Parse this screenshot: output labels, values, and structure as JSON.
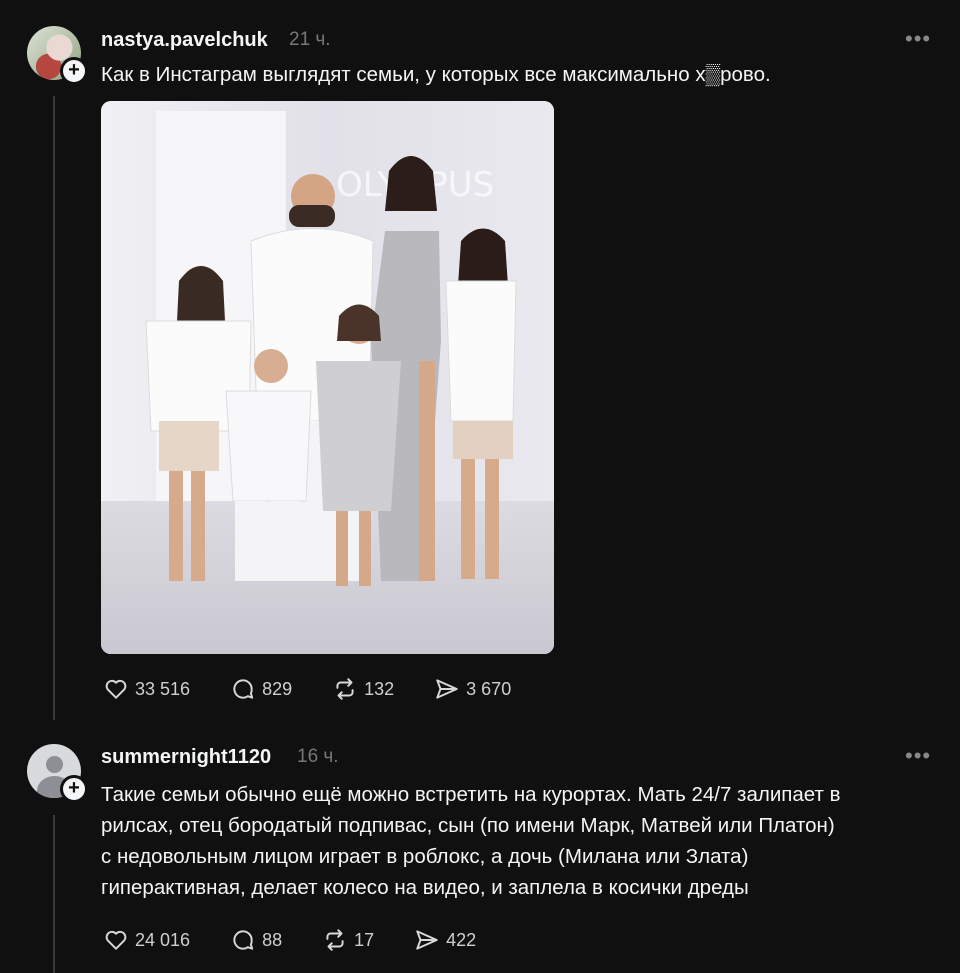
{
  "posts": [
    {
      "username": "nastya.pavelchuk",
      "time": "21 ч.",
      "more": "•••",
      "text": "Как в Инстаграм выглядят семьи, у которых все максимально х▒рово.",
      "image_sign": "OLYMPUS",
      "stats": {
        "likes": "33 516",
        "comments": "829",
        "reposts": "132",
        "shares": "3 670"
      }
    },
    {
      "username": "summernight1120",
      "time": "16 ч.",
      "more": "•••",
      "text_lines": [
        "Такие семьи обычно ещё можно встретить на курортах. Мать 24/7 залипает в",
        "рилсах, отец бородатый подпивас, сын (по имени Марк, Матвей или Платон)",
        "с недовольным лицом играет в роблокс, а дочь (Милана или Злата)",
        "гиперактивная, делает колесо на видео, и заплела в косички дреды"
      ],
      "stats": {
        "likes": "24 016",
        "comments": "88",
        "reposts": "17",
        "shares": "422"
      }
    }
  ],
  "icons": [
    "heart-icon",
    "comment-icon",
    "repost-icon",
    "share-icon",
    "plus-icon",
    "more-icon"
  ],
  "colors": {
    "background": "#101010",
    "text": "#f3f5f7",
    "muted": "#777777",
    "thread_line": "#3a3a3a"
  }
}
